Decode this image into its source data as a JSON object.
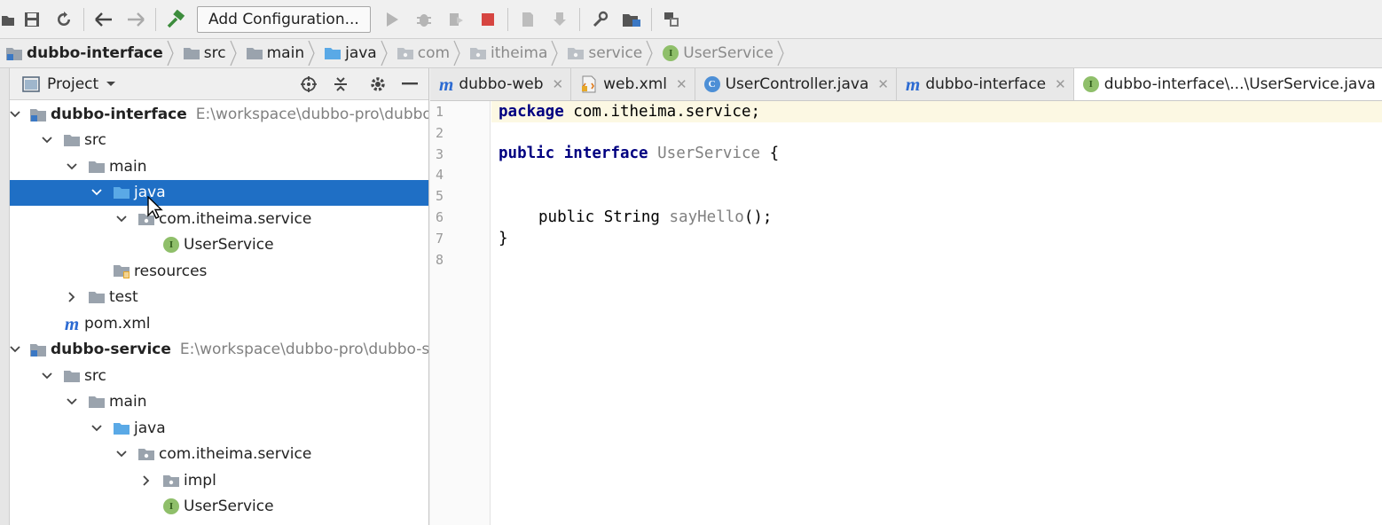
{
  "toolbar": {
    "run_config_label": "Add Configuration..."
  },
  "breadcrumb": [
    {
      "label": "dubbo-interface",
      "bold": true,
      "dim": false
    },
    {
      "label": "src",
      "bold": false,
      "dim": false
    },
    {
      "label": "main",
      "bold": false,
      "dim": false
    },
    {
      "label": "java",
      "bold": false,
      "dim": false
    },
    {
      "label": "com",
      "bold": false,
      "dim": true
    },
    {
      "label": "itheima",
      "bold": false,
      "dim": true
    },
    {
      "label": "service",
      "bold": false,
      "dim": true
    },
    {
      "label": "UserService",
      "bold": false,
      "dim": true
    }
  ],
  "project_panel": {
    "title": "Project",
    "tree": [
      {
        "label": "dubbo-interface",
        "hint": "E:\\workspace\\dubbo-pro\\dubbo-interface",
        "icon": "module-icon",
        "indent": 0,
        "arrow": "down",
        "bold": true
      },
      {
        "label": "src",
        "icon": "folder-icon",
        "indent": 1,
        "arrow": "down"
      },
      {
        "label": "main",
        "icon": "folder-icon",
        "indent": 2,
        "arrow": "down"
      },
      {
        "label": "java",
        "icon": "source-folder-icon",
        "indent": 3,
        "arrow": "down",
        "selected": true
      },
      {
        "label": "com.itheima.service",
        "icon": "package-icon",
        "indent": 4,
        "arrow": "down"
      },
      {
        "label": "UserService",
        "icon": "interface-icon",
        "indent": 5,
        "arrow": "none"
      },
      {
        "label": "resources",
        "icon": "resources-folder-icon",
        "indent": 3,
        "arrow": "none"
      },
      {
        "label": "test",
        "icon": "folder-icon",
        "indent": 2,
        "arrow": "right"
      },
      {
        "label": "pom.xml",
        "icon": "maven-icon",
        "indent": 1,
        "arrow": "none"
      },
      {
        "label": "dubbo-service",
        "hint": "E:\\workspace\\dubbo-pro\\dubbo-service",
        "icon": "module-icon",
        "indent": 0,
        "arrow": "down",
        "bold": true
      },
      {
        "label": "src",
        "icon": "folder-icon",
        "indent": 1,
        "arrow": "down"
      },
      {
        "label": "main",
        "icon": "folder-icon",
        "indent": 2,
        "arrow": "down"
      },
      {
        "label": "java",
        "icon": "source-folder-icon",
        "indent": 3,
        "arrow": "down"
      },
      {
        "label": "com.itheima.service",
        "icon": "package-icon",
        "indent": 4,
        "arrow": "down"
      },
      {
        "label": "impl",
        "icon": "package-icon",
        "indent": 5,
        "arrow": "right"
      },
      {
        "label": "UserService",
        "icon": "interface-icon",
        "indent": 5,
        "arrow": "none"
      }
    ]
  },
  "tabs": [
    {
      "label": "dubbo-web",
      "icon": "maven-icon",
      "active": false
    },
    {
      "label": "web.xml",
      "icon": "xml-file-icon",
      "active": false
    },
    {
      "label": "UserController.java",
      "icon": "class-icon",
      "active": false
    },
    {
      "label": "dubbo-interface",
      "icon": "maven-icon",
      "active": false
    },
    {
      "label": "dubbo-interface\\...\\UserService.java",
      "icon": "interface-icon",
      "active": true
    }
  ],
  "editor": {
    "line_numbers": [
      "1",
      "2",
      "3",
      "4",
      "5",
      "6",
      "7",
      "8"
    ],
    "code": {
      "l1_kw": "package",
      "l1_rest": " com.itheima.service;",
      "l3_kw1": "public",
      "l3_kw2": "interface",
      "l3_name": "UserService",
      "l3_brace": " {",
      "l6_kw": "public",
      "l6_type": " String ",
      "l6_method": "sayHello",
      "l6_rest": "();",
      "l7": "}"
    }
  },
  "colors": {
    "selection": "#1f6fc5",
    "keyword": "#000080",
    "interface_badge": "#8fbf6a",
    "class_badge": "#4d8fd6",
    "folder": "#9aa3ad",
    "source_folder": "#5aa9e6"
  }
}
